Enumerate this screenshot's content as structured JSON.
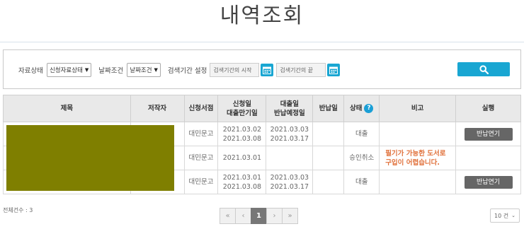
{
  "title": "내역조회",
  "filters": {
    "status_label": "자료상태",
    "status_value": "신청자료상태",
    "date_cond_label": "날짜조건",
    "date_cond_value": "날짜조건",
    "period_label": "검색기간 설정",
    "start_placeholder": "검색기간의 시작",
    "end_placeholder": "검색기간의 끝",
    "search_icon": "search-icon",
    "calendar_icon": "calendar-icon"
  },
  "table": {
    "headers": {
      "title": "제목",
      "author": "저작자",
      "store": "신청서점",
      "apply_l1": "신청일",
      "apply_l2": "대출만기일",
      "loan_l1": "대출일",
      "loan_l2": "반납예정일",
      "return": "반납일",
      "status": "상태",
      "note": "비고",
      "action": "실행"
    },
    "rows": [
      {
        "store": "대민문고",
        "apply": "2021.03.02",
        "due": "2021.03.08",
        "loan": "2021.03.03",
        "return_due": "2021.03.17",
        "returned": "",
        "status": "대출",
        "note_l1": "",
        "note_l2": "",
        "action": "반납연기"
      },
      {
        "store": "대민문고",
        "apply": "2021.03.01",
        "due": "",
        "loan": "",
        "return_due": "",
        "returned": "",
        "status": "승인취소",
        "note_l1": "필기가 가능한 도서로",
        "note_l2": "구입이 어렵습니다.",
        "action": ""
      },
      {
        "store": "대민문고",
        "apply": "2021.03.01",
        "due": "2021.03.08",
        "loan": "2021.03.03",
        "return_due": "2021.03.17",
        "returned": "",
        "status": "대출",
        "note_l1": "",
        "note_l2": "",
        "action": "반납연기"
      }
    ]
  },
  "footer": {
    "total": "전체건수 : 3",
    "pages": {
      "first": "«",
      "prev": "‹",
      "current": "1",
      "next": "›",
      "last": "»"
    },
    "per_page": "10 건"
  },
  "colors": {
    "accent": "#19a6d2",
    "cover": "#7f7f00",
    "note": "#e0703a"
  }
}
